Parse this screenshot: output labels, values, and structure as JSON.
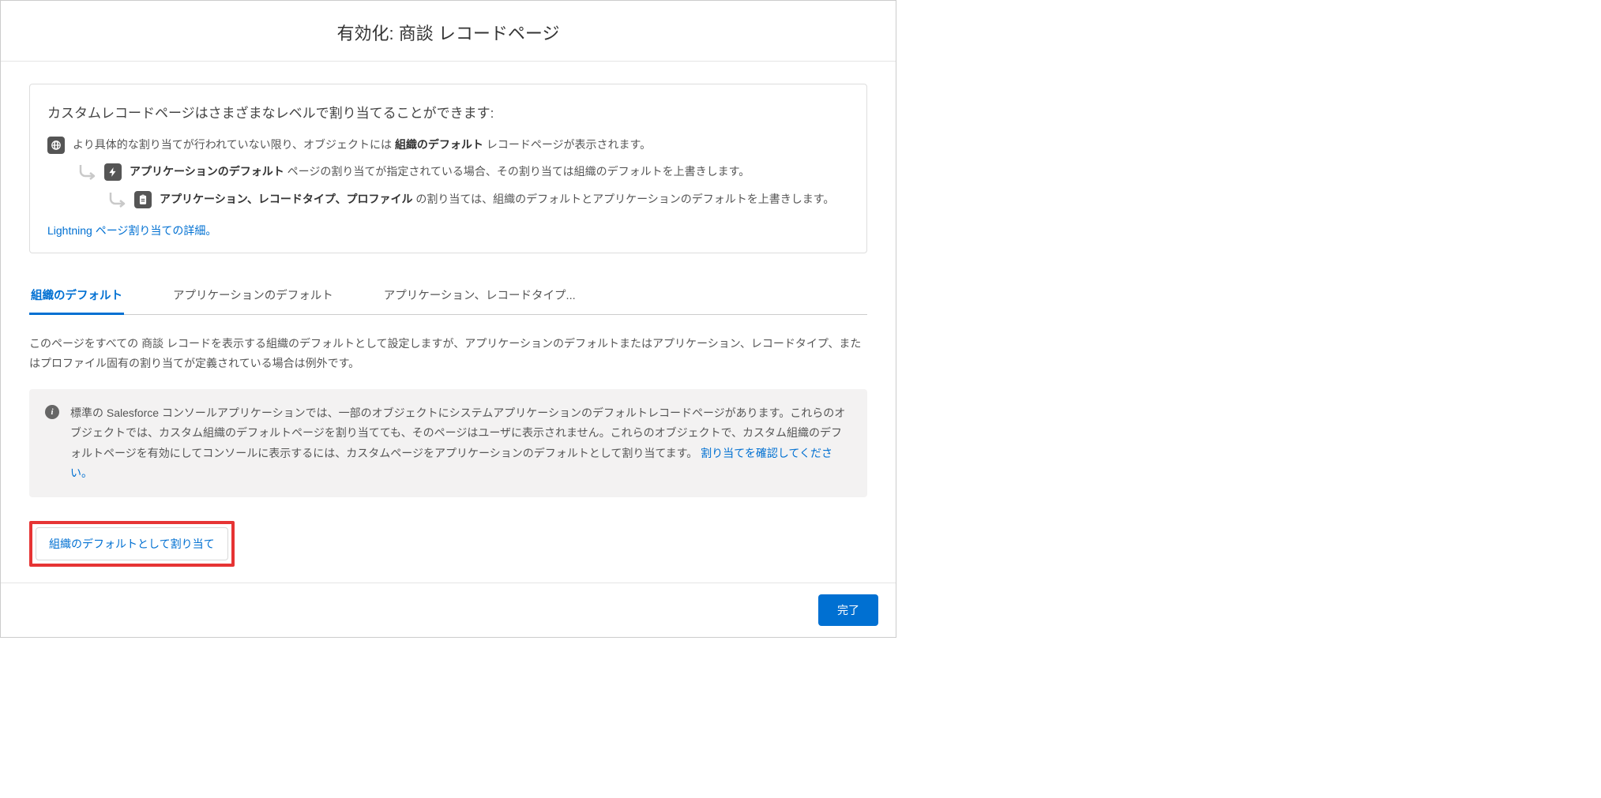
{
  "modal": {
    "title": "有効化: 商談 レコードページ"
  },
  "info_card": {
    "title": "カスタムレコードページはさまざまなレベルで割り当てることができます:",
    "level1_pre": "より具体的な割り当てが行われていない限り、オブジェクトには ",
    "level1_bold": "組織のデフォルト",
    "level1_post": " レコードページが表示されます。",
    "level2_bold": "アプリケーションのデフォルト",
    "level2_post": " ページの割り当てが指定されている場合、その割り当ては組織のデフォルトを上書きします。",
    "level3_bold": "アプリケーション、レコードタイプ、プロファイル",
    "level3_post": " の割り当ては、組織のデフォルトとアプリケーションのデフォルトを上書きします。",
    "link_text": "Lightning ページ割り当ての詳細。"
  },
  "tabs": [
    {
      "label": "組織のデフォルト",
      "active": true
    },
    {
      "label": "アプリケーションのデフォルト",
      "active": false
    },
    {
      "label": "アプリケーション、レコードタイプ...",
      "active": false
    }
  ],
  "tab_content": {
    "description": "このページをすべての 商談 レコードを表示する組織のデフォルトとして設定しますが、アプリケーションのデフォルトまたはアプリケーション、レコードタイプ、またはプロファイル固有の割り当てが定義されている場合は例外です。",
    "alert_text": "標準の Salesforce コンソールアプリケーションでは、一部のオブジェクトにシステムアプリケーションのデフォルトレコードページがあります。これらのオブジェクトでは、カスタム組織のデフォルトページを割り当てても、そのページはユーザに表示されません。これらのオブジェクトで、カスタム組織のデフォルトページを有効にしてコンソールに表示するには、カスタムページをアプリケーションのデフォルトとして割り当てます。 ",
    "alert_link": "割り当てを確認してください。",
    "assign_button": "組織のデフォルトとして割り当て"
  },
  "footer": {
    "done_button": "完了"
  },
  "icons": {
    "globe": "globe-icon",
    "bolt": "bolt-icon",
    "clipboard": "clipboard-icon",
    "info": "i"
  }
}
